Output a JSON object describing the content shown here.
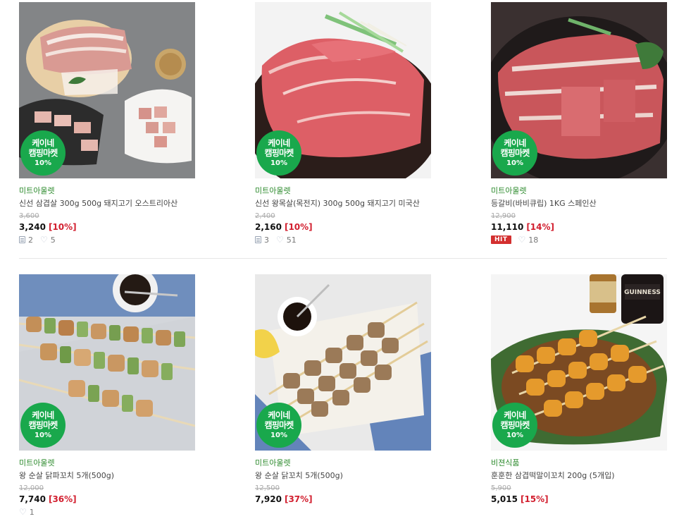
{
  "products": [
    {
      "seller": "미트아울렛",
      "name": "신선 삼겹살 300g 500g 돼지고기 오스트리아산",
      "original_price": "3,600",
      "price": "3,240",
      "discount": "[10%]",
      "reviews": "2",
      "likes": "5",
      "hit": "",
      "badge": {
        "line1": "케이네",
        "line2": "캠핑마켓",
        "line3": "10%"
      },
      "image": "pork-belly-image"
    },
    {
      "seller": "미트아울렛",
      "name": "신선 왕목살(목전지) 300g 500g 돼지고기 미국산",
      "original_price": "2,400",
      "price": "2,160",
      "discount": "[10%]",
      "reviews": "3",
      "likes": "51",
      "hit": "",
      "badge": {
        "line1": "케이네",
        "line2": "캠핑마켓",
        "line3": "10%"
      },
      "image": "pork-neck-image"
    },
    {
      "seller": "미트아울렛",
      "name": "등갈비(바비큐립) 1KG 스페인산",
      "original_price": "12,900",
      "price": "11,110",
      "discount": "[14%]",
      "reviews": "",
      "likes": "18",
      "hit": "HIT",
      "badge": {
        "line1": "케이네",
        "line2": "캠핑마켓",
        "line3": "10%"
      },
      "image": "pork-ribs-image"
    },
    {
      "seller": "미트아울렛",
      "name": "왕 순살 닭파꼬치 5개(500g)",
      "original_price": "12,000",
      "price": "7,740",
      "discount": "[36%]",
      "reviews": "",
      "likes": "1",
      "hit": "",
      "badge": {
        "line1": "케이네",
        "line2": "캠핑마켓",
        "line3": "10%"
      },
      "image": "chicken-leek-skewer-image"
    },
    {
      "seller": "미트아울렛",
      "name": "왕 순살 닭꼬치 5개(500g)",
      "original_price": "12,500",
      "price": "7,920",
      "discount": "[37%]",
      "reviews": "",
      "likes": "",
      "hit": "",
      "badge": {
        "line1": "케이네",
        "line2": "캠핑마켓",
        "line3": "10%"
      },
      "image": "chicken-skewer-image"
    },
    {
      "seller": "비젼식품",
      "name": "훈훈한 삼겹떡말이꼬치 200g (5개입)",
      "original_price": "5,900",
      "price": "5,015",
      "discount": "[15%]",
      "reviews": "",
      "likes": "",
      "hit": "",
      "badge": {
        "line1": "케이네",
        "line2": "캠핑마켓",
        "line3": "10%"
      },
      "image": "pork-rice-cake-skewer-image"
    }
  ],
  "image_labels": {
    "bottle_text": "GUINNESS"
  },
  "colors": {
    "badge_green": "#19a84c",
    "seller_green": "#2d8b2d",
    "discount_red": "#d21f2f",
    "hit_red": "#d32f2f"
  }
}
